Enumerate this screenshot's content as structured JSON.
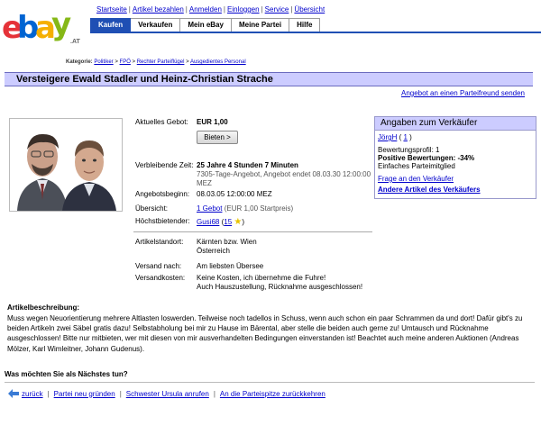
{
  "brand": {
    "logo_letters": [
      "e",
      "b",
      "a",
      "y"
    ],
    "domain": ".AT",
    "colors": {
      "e": "#e53238",
      "b": "#0064d2",
      "a": "#f5af02",
      "y": "#86b817"
    }
  },
  "top_links": [
    "Startseite",
    "Artikel bezahlen",
    "Anmelden",
    "Einloggen",
    "Service",
    "Übersicht"
  ],
  "nav": {
    "tabs": [
      "Kaufen",
      "Verkaufen",
      "Mein eBay",
      "Meine Partei",
      "Hilfe"
    ],
    "active": "Kaufen",
    "accent": "#1f4fb4"
  },
  "breadcrumb": {
    "label": "Kategorie:",
    "items": [
      "Politiker",
      "FPÖ",
      "Rechter Parteiflügel",
      "Ausgedientes Personal"
    ]
  },
  "title": "Versteigere Ewald Stadler und Heinz-Christian Strache",
  "send_link": "Angebot an einen Parteifreund senden",
  "details": {
    "current_bid_label": "Aktuelles Gebot:",
    "current_bid_value": "EUR 1,00",
    "bid_button": "Bieten >",
    "remaining_label": "Verbleibende Zeit:",
    "remaining_value": "25 Jahre 4 Stunden 7 Minuten",
    "remaining_note_1": "7305-Tage-Angebot, Angebot endet 08.03.30   12:00:00",
    "remaining_note_2": "MEZ",
    "start_label": "Angebotsbeginn:",
    "start_value": "08.03.05   12:00:00 MEZ",
    "overview_label": "Übersicht:",
    "overview_link": "1 Gebot",
    "overview_note": "(EUR 1,00 Startpreis)",
    "highest_label": "Höchstbietender:",
    "highest_user": "Gusi68",
    "highest_rating": "15",
    "location_label": "Artikelstandort:",
    "location_value_1": "Kärnten bzw. Wien",
    "location_value_2": "Österreich",
    "shipping_label": "Versand nach:",
    "shipping_value": "Am liebsten Übersee",
    "shipcost_label": "Versandkosten:",
    "shipcost_value_1": "Keine Kosten, ich übernehme die Fuhre!",
    "shipcost_value_2": "Auch Hauszustellung, Rücknahme ausgeschlossen!"
  },
  "seller": {
    "header": "Angaben zum Verkäufer",
    "name": "JörgH",
    "rating": "1",
    "profile": "Bewertungsprofil: 1",
    "positive": "Positive Bewertungen: -34%",
    "member": "Einfaches Parteimitglied",
    "ask_link": "Frage an den Verkäufer",
    "other_link": "Andere Artikel des Verkäufers"
  },
  "description": {
    "title": "Artikelbeschreibung:",
    "text": "Muss wegen Neuorientierung mehrere Altlasten loswerden. Teilweise noch tadellos in Schuss, wenn auch schon ein paar Schrammen da und dort! Dafür gibt's zu beiden Artikeln zwei Säbel gratis dazu! Selbstabholung bei mir zu Hause im Bärental, aber stelle die beiden auch gerne zu! Umtausch und Rücknahme ausgeschlossen! Bitte nur mitbieten, wer mit diesen von mir ausverhandelten Bedingungen einverstanden ist! Beachtet auch meine anderen Auktionen (Andreas Mölzer, Karl Wimleitner, Johann Gudenus)."
  },
  "next": {
    "question": "Was möchten Sie als Nächstes tun?",
    "links": [
      "zurück",
      "Partei neu gründen",
      "Schwester Ursula anrufen",
      "An die Parteispitze zurückkehren"
    ]
  }
}
